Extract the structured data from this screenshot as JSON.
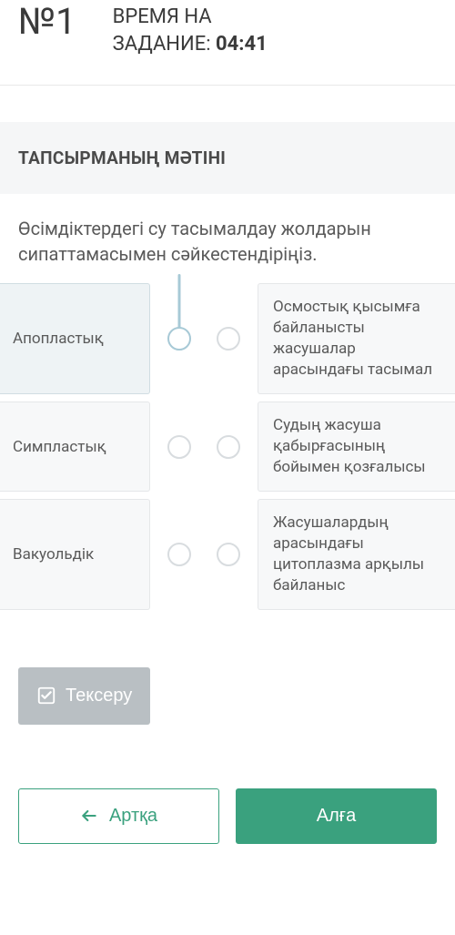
{
  "header": {
    "question_number": "№1",
    "timer_label_line1": "ВРЕМЯ НА",
    "timer_label_line2": "ЗАДАНИЕ:",
    "timer_value": "04:41"
  },
  "task": {
    "section_title": "ТАПСЫРМАНЫҢ МӘТІНІ",
    "prompt": "Өсімдіктердегі су тасымалдау жолдарын сипаттамасымен сәйкестендіріңіз."
  },
  "matching": {
    "left": [
      {
        "label": "Апопластық",
        "selected": true
      },
      {
        "label": "Симпластық",
        "selected": false
      },
      {
        "label": "Вакуольдік",
        "selected": false
      }
    ],
    "right": [
      {
        "label": "Осмостық қысымға байланысты жасушалар арасындағы тасымал"
      },
      {
        "label": "Судың жасуша қабырғасының бойымен қозғалысы"
      },
      {
        "label": "Жасушалардың арасындағы цитоплазма арқылы байланыс"
      }
    ]
  },
  "buttons": {
    "check": "Тексеру",
    "back": "Артқа",
    "forward": "Алға"
  }
}
